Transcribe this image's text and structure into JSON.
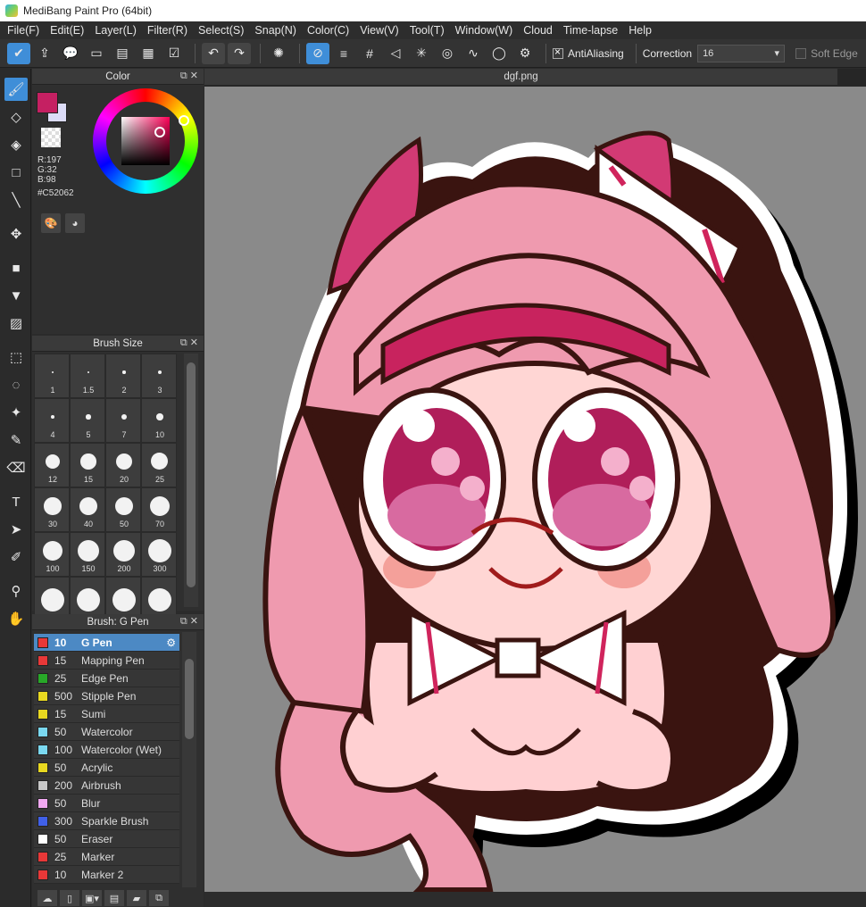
{
  "window": {
    "title": "MediBang Paint Pro (64bit)"
  },
  "menu": [
    "File(F)",
    "Edit(E)",
    "Layer(L)",
    "Filter(R)",
    "Select(S)",
    "Snap(N)",
    "Color(C)",
    "View(V)",
    "Tool(T)",
    "Window(W)",
    "Cloud",
    "Time-lapse",
    "Help"
  ],
  "toolbar": {
    "antialiasing_label": "AntiAliasing",
    "correction_label": "Correction",
    "correction_value": "16",
    "soft_edge_label": "Soft Edge"
  },
  "color_panel": {
    "title": "Color",
    "rgb": [
      "R:197",
      "G:32",
      "B:98"
    ],
    "hex": "#C52062",
    "primary_color": "#c52062",
    "secondary_color": "#dcdcf8"
  },
  "brush_size_panel": {
    "title": "Brush Size",
    "sizes": [
      "1",
      "1.5",
      "2",
      "3",
      "4",
      "5",
      "7",
      "10",
      "12",
      "15",
      "20",
      "25",
      "30",
      "40",
      "50",
      "70",
      "100",
      "150",
      "200",
      "300",
      "",
      "",
      "",
      ""
    ]
  },
  "brush_panel": {
    "title": "Brush: G Pen",
    "brushes": [
      {
        "size": "10",
        "name": "G Pen",
        "color": "#e83838",
        "selected": true
      },
      {
        "size": "15",
        "name": "Mapping Pen",
        "color": "#e83838"
      },
      {
        "size": "25",
        "name": "Edge Pen",
        "color": "#28a828"
      },
      {
        "size": "500",
        "name": "Stipple Pen",
        "color": "#e8d820"
      },
      {
        "size": "15",
        "name": "Sumi",
        "color": "#e8d820"
      },
      {
        "size": "50",
        "name": "Watercolor",
        "color": "#7ad8f0"
      },
      {
        "size": "100",
        "name": "Watercolor (Wet)",
        "color": "#7ad8f0"
      },
      {
        "size": "50",
        "name": "Acrylic",
        "color": "#e8d820"
      },
      {
        "size": "200",
        "name": "Airbrush",
        "color": "#c8c8c8"
      },
      {
        "size": "50",
        "name": "Blur",
        "color": "#f0a8f0"
      },
      {
        "size": "300",
        "name": "Sparkle Brush",
        "color": "#4060e8"
      },
      {
        "size": "50",
        "name": "Eraser",
        "color": "#ffffff"
      },
      {
        "size": "25",
        "name": "Marker",
        "color": "#e83838"
      },
      {
        "size": "10",
        "name": "Marker 2",
        "color": "#e83838"
      }
    ]
  },
  "canvas": {
    "tab_title": "dgf.png"
  }
}
